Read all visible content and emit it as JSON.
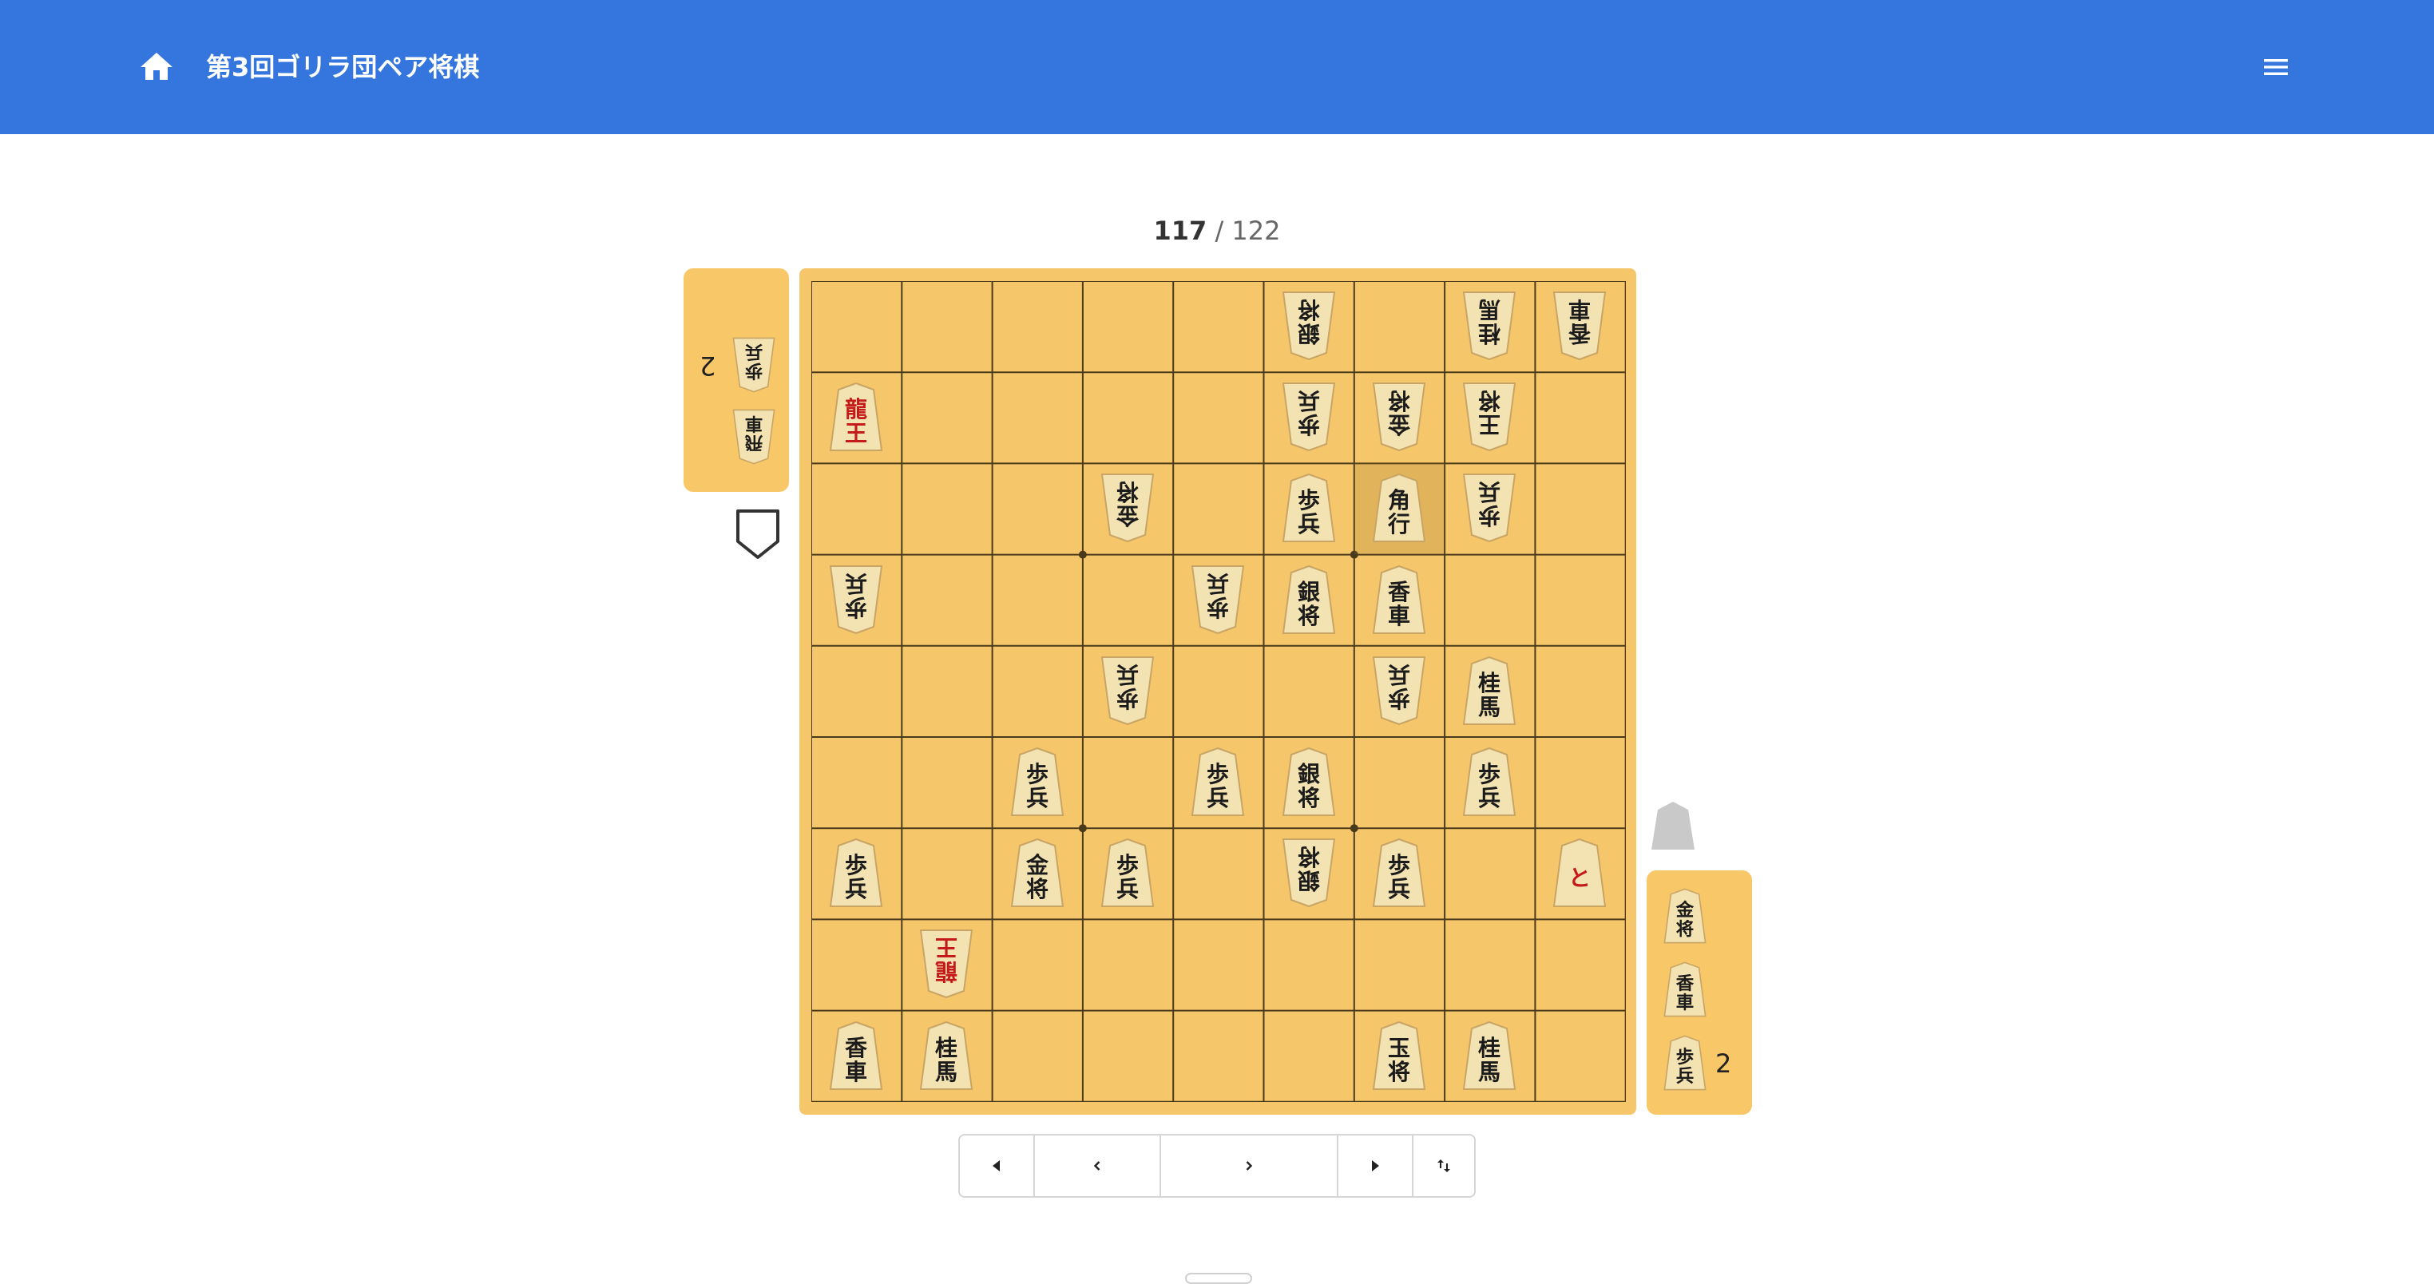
{
  "header": {
    "title": "第3回ゴリラ団ペア将棋",
    "home_icon": "home-icon",
    "menu_icon": "menu-icon",
    "background": "#3476dd"
  },
  "move_counter": {
    "current": "117",
    "separator": " / ",
    "total": "122"
  },
  "board": {
    "files": 9,
    "ranks": 9,
    "last_move": "3三",
    "pieces": [
      {
        "sq": "4一",
        "owner": "gote",
        "t1": "銀",
        "t2": "将",
        "red": false
      },
      {
        "sq": "2一",
        "owner": "gote",
        "t1": "桂",
        "t2": "馬",
        "red": false
      },
      {
        "sq": "1一",
        "owner": "gote",
        "t1": "香",
        "t2": "車",
        "red": false
      },
      {
        "sq": "9二",
        "owner": "sente",
        "t1": "龍",
        "t2": "王",
        "red": true
      },
      {
        "sq": "4二",
        "owner": "gote",
        "t1": "歩",
        "t2": "兵",
        "red": false
      },
      {
        "sq": "3二",
        "owner": "gote",
        "t1": "金",
        "t2": "将",
        "red": false
      },
      {
        "sq": "2二",
        "owner": "gote",
        "t1": "王",
        "t2": "将",
        "red": false
      },
      {
        "sq": "6三",
        "owner": "gote",
        "t1": "金",
        "t2": "将",
        "red": false
      },
      {
        "sq": "4三",
        "owner": "sente",
        "t1": "歩",
        "t2": "兵",
        "red": false
      },
      {
        "sq": "3三",
        "owner": "sente",
        "t1": "角",
        "t2": "行",
        "red": false
      },
      {
        "sq": "2三",
        "owner": "gote",
        "t1": "歩",
        "t2": "兵",
        "red": false
      },
      {
        "sq": "9四",
        "owner": "gote",
        "t1": "歩",
        "t2": "兵",
        "red": false
      },
      {
        "sq": "5四",
        "owner": "gote",
        "t1": "歩",
        "t2": "兵",
        "red": false
      },
      {
        "sq": "4四",
        "owner": "sente",
        "t1": "銀",
        "t2": "将",
        "red": false
      },
      {
        "sq": "3四",
        "owner": "sente",
        "t1": "香",
        "t2": "車",
        "red": false
      },
      {
        "sq": "6五",
        "owner": "gote",
        "t1": "歩",
        "t2": "兵",
        "red": false
      },
      {
        "sq": "3五",
        "owner": "gote",
        "t1": "歩",
        "t2": "兵",
        "red": false
      },
      {
        "sq": "2五",
        "owner": "sente",
        "t1": "桂",
        "t2": "馬",
        "red": false
      },
      {
        "sq": "7六",
        "owner": "sente",
        "t1": "歩",
        "t2": "兵",
        "red": false
      },
      {
        "sq": "5六",
        "owner": "sente",
        "t1": "歩",
        "t2": "兵",
        "red": false
      },
      {
        "sq": "4六",
        "owner": "sente",
        "t1": "銀",
        "t2": "将",
        "red": false
      },
      {
        "sq": "2六",
        "owner": "sente",
        "t1": "歩",
        "t2": "兵",
        "red": false
      },
      {
        "sq": "9七",
        "owner": "sente",
        "t1": "歩",
        "t2": "兵",
        "red": false
      },
      {
        "sq": "7七",
        "owner": "sente",
        "t1": "金",
        "t2": "将",
        "red": false
      },
      {
        "sq": "6七",
        "owner": "sente",
        "t1": "歩",
        "t2": "兵",
        "red": false
      },
      {
        "sq": "4七",
        "owner": "gote",
        "t1": "銀",
        "t2": "将",
        "red": false
      },
      {
        "sq": "3七",
        "owner": "sente",
        "t1": "歩",
        "t2": "兵",
        "red": false
      },
      {
        "sq": "1七",
        "owner": "sente",
        "t1": "と",
        "t2": "",
        "red": true
      },
      {
        "sq": "8八",
        "owner": "gote",
        "t1": "龍",
        "t2": "王",
        "red": true
      },
      {
        "sq": "9九",
        "owner": "sente",
        "t1": "香",
        "t2": "車",
        "red": false
      },
      {
        "sq": "8九",
        "owner": "sente",
        "t1": "桂",
        "t2": "馬",
        "red": false
      },
      {
        "sq": "3九",
        "owner": "sente",
        "t1": "玉",
        "t2": "将",
        "red": false
      },
      {
        "sq": "2九",
        "owner": "sente",
        "t1": "桂",
        "t2": "馬",
        "red": false
      }
    ]
  },
  "hands": {
    "gote": [
      {
        "t1": "歩",
        "t2": "兵",
        "count": "2"
      },
      {
        "t1": "飛",
        "t2": "車",
        "count": ""
      }
    ],
    "sente": [
      {
        "t1": "金",
        "t2": "将",
        "count": ""
      },
      {
        "t1": "香",
        "t2": "車",
        "count": ""
      },
      {
        "t1": "歩",
        "t2": "兵",
        "count": "2"
      }
    ]
  },
  "turn_indicators": {
    "gote": "shield-outline-icon",
    "sente": "pentagon-filled-icon"
  },
  "controls": [
    {
      "name": "first-move-button",
      "icon": "skip-first-icon"
    },
    {
      "name": "prev-move-button",
      "icon": "chevron-left-icon"
    },
    {
      "name": "next-move-button",
      "icon": "chevron-right-icon"
    },
    {
      "name": "last-move-button",
      "icon": "skip-last-icon"
    },
    {
      "name": "flip-board-button",
      "icon": "swap-vertical-icon"
    }
  ]
}
